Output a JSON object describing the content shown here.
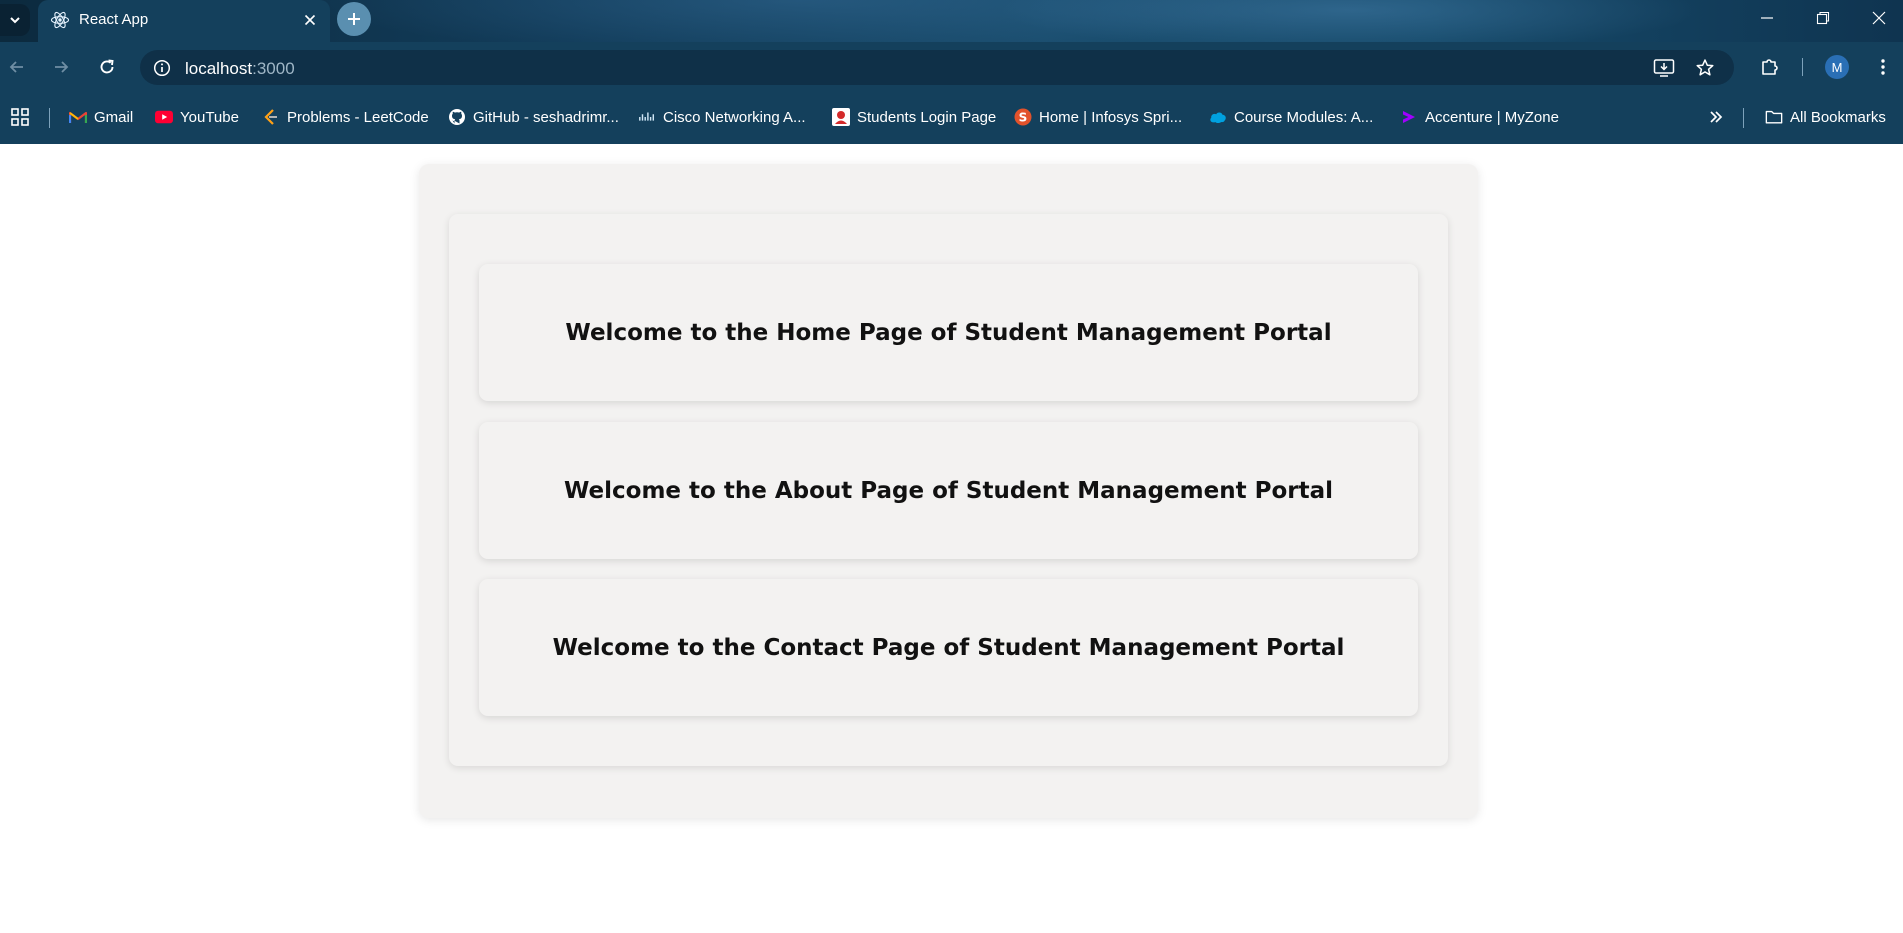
{
  "browser": {
    "tab": {
      "title": "React App"
    },
    "address": {
      "host": "localhost",
      "port": ":3000"
    },
    "profile_initial": "M",
    "bookmarks": [
      {
        "label": "Gmail",
        "icon": "gmail-icon"
      },
      {
        "label": "YouTube",
        "icon": "youtube-icon"
      },
      {
        "label": "Problems - LeetCode",
        "icon": "leetcode-icon"
      },
      {
        "label": "GitHub - seshadrimr...",
        "icon": "github-icon"
      },
      {
        "label": "Cisco Networking A...",
        "icon": "cisco-icon"
      },
      {
        "label": "Students Login Page",
        "icon": "students-login-icon"
      },
      {
        "label": "Home | Infosys Spri...",
        "icon": "infosys-icon"
      },
      {
        "label": "Course Modules: A...",
        "icon": "salesforce-icon"
      },
      {
        "label": "Accenture | MyZone",
        "icon": "accenture-icon"
      }
    ],
    "all_bookmarks_label": "All Bookmarks"
  },
  "page": {
    "sections": [
      {
        "heading": "Welcome to the Home Page of Student Management Portal"
      },
      {
        "heading": "Welcome to the About Page of Student Management Portal"
      },
      {
        "heading": "Welcome to the Contact Page of Student Management Portal"
      }
    ]
  },
  "colors": {
    "chrome_bg": "#14405c",
    "card_bg": "#f3f2f1",
    "heading_text": "#111111"
  }
}
